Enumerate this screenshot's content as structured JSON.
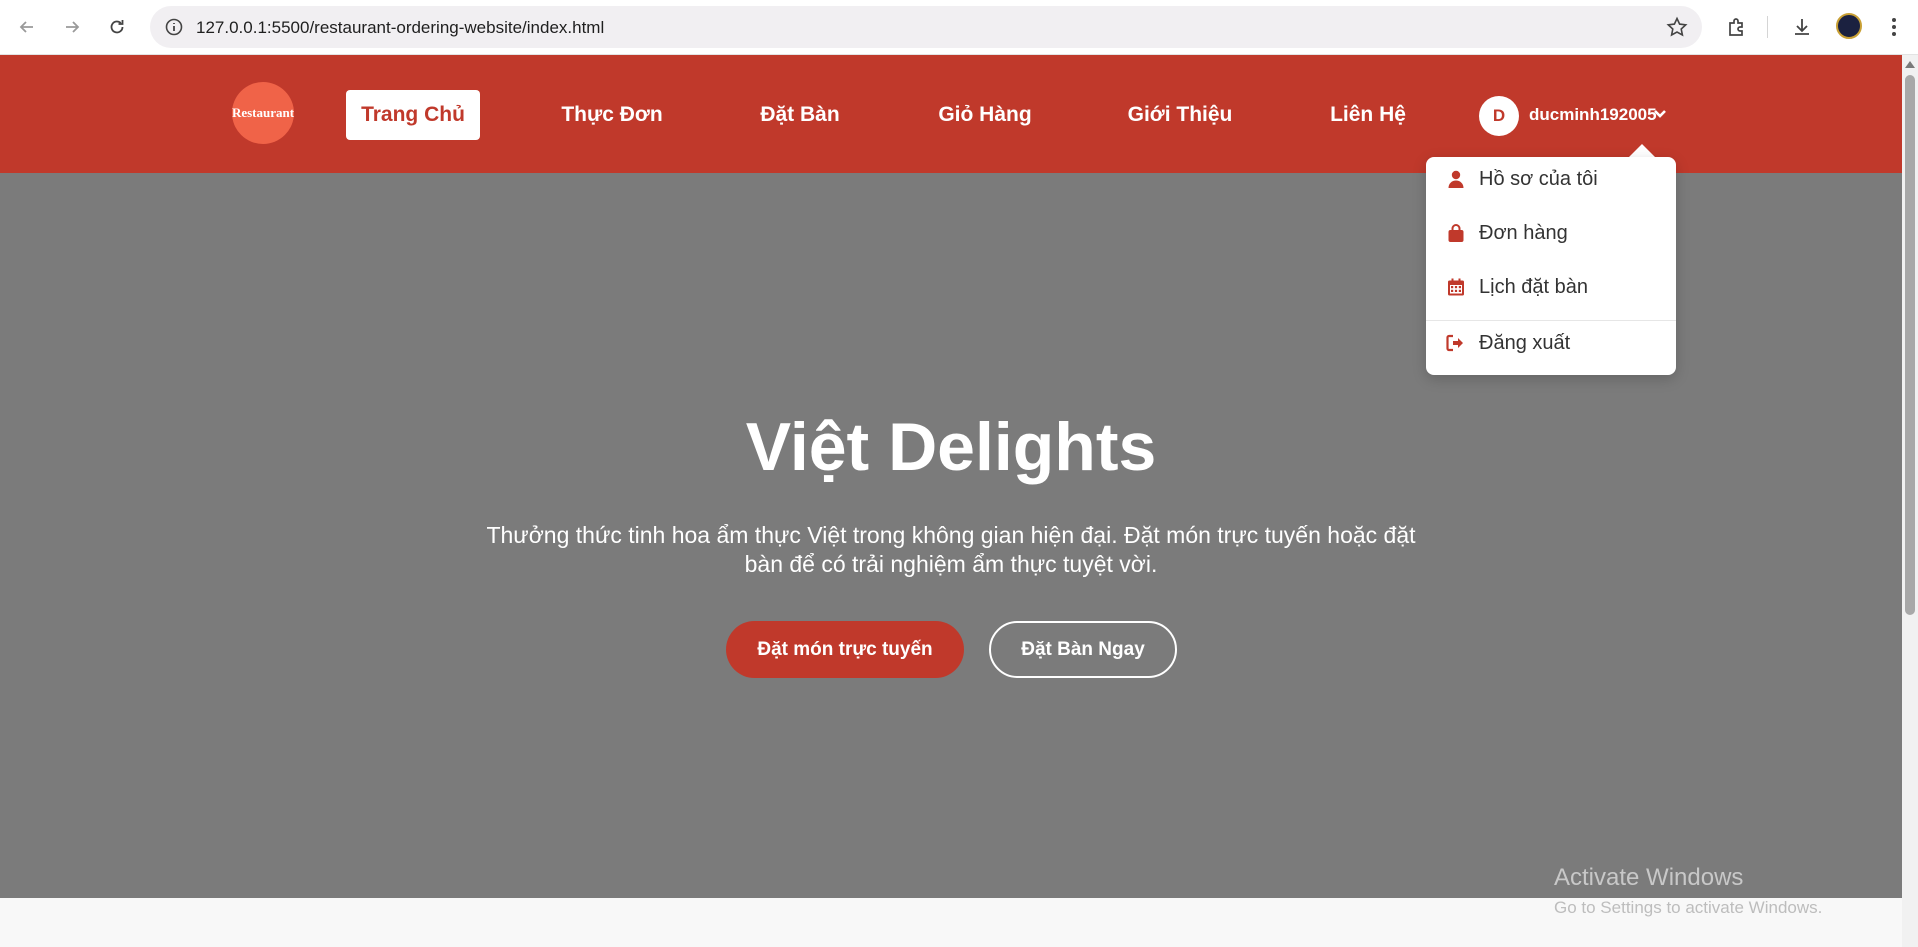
{
  "browser": {
    "url": "127.0.0.1:5500/restaurant-ordering-website/index.html"
  },
  "site": {
    "logo_text": "Restaurant",
    "nav": [
      {
        "label": "Trang Chủ",
        "active": true
      },
      {
        "label": "Thực Đơn",
        "active": false
      },
      {
        "label": "Đặt Bàn",
        "active": false
      },
      {
        "label": "Giỏ Hàng",
        "active": false
      },
      {
        "label": "Giới Thiệu",
        "active": false
      },
      {
        "label": "Liên Hệ",
        "active": false
      }
    ],
    "user": {
      "initial": "D",
      "name": "ducminh192005"
    },
    "user_menu": [
      {
        "label": "Hồ sơ của tôi",
        "icon": "user-icon"
      },
      {
        "label": "Đơn hàng",
        "icon": "shopping-bag-icon"
      },
      {
        "label": "Lịch đặt bàn",
        "icon": "calendar-icon"
      },
      {
        "label": "Đăng xuất",
        "icon": "sign-out-icon"
      }
    ]
  },
  "hero": {
    "title": "Việt Delights",
    "subtitle": "Thưởng thức tinh hoa ẩm thực Việt trong không gian hiện đại. Đặt món trực tuyến hoặc đặt bàn để có trải nghiệm ẩm thực tuyệt vời.",
    "primary_button": "Đặt món trực tuyến",
    "secondary_button": "Đặt Bàn Ngay"
  },
  "watermark": {
    "title": "Activate Windows",
    "subtitle": "Go to Settings to activate Windows."
  },
  "colors": {
    "brand_red": "#c0392b",
    "logo_orange": "#f06348",
    "hero_gray": "#7b7b7b"
  }
}
